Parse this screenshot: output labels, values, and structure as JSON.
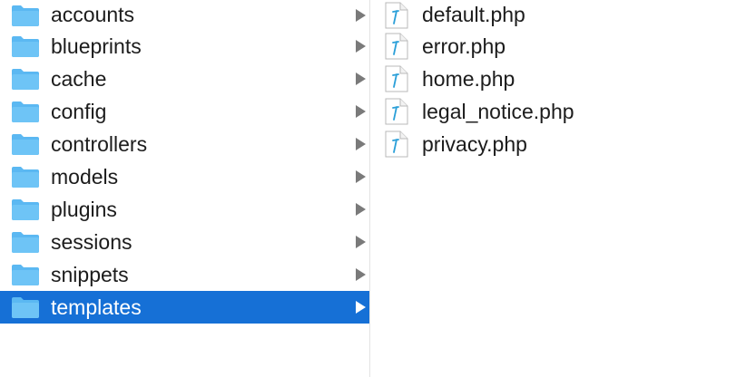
{
  "folders": [
    {
      "label": "accounts"
    },
    {
      "label": "blueprints"
    },
    {
      "label": "cache"
    },
    {
      "label": "config"
    },
    {
      "label": "controllers"
    },
    {
      "label": "models"
    },
    {
      "label": "plugins"
    },
    {
      "label": "sessions"
    },
    {
      "label": "snippets"
    },
    {
      "label": "templates"
    }
  ],
  "files": [
    {
      "label": "default.php"
    },
    {
      "label": "error.php"
    },
    {
      "label": "home.php"
    },
    {
      "label": "legal_notice.php"
    },
    {
      "label": "privacy.php"
    }
  ],
  "selected_folder": "templates",
  "colors": {
    "selection": "#1670d6",
    "folder_icon": "#5bb8f2",
    "chevron": "#7a7a7a",
    "text": "#1c1c1c",
    "file_icon_accent": "#2a9fd8"
  },
  "icons": {
    "folder": "folder-icon",
    "file": "php-file-icon",
    "chevron": "chevron-right-icon"
  }
}
